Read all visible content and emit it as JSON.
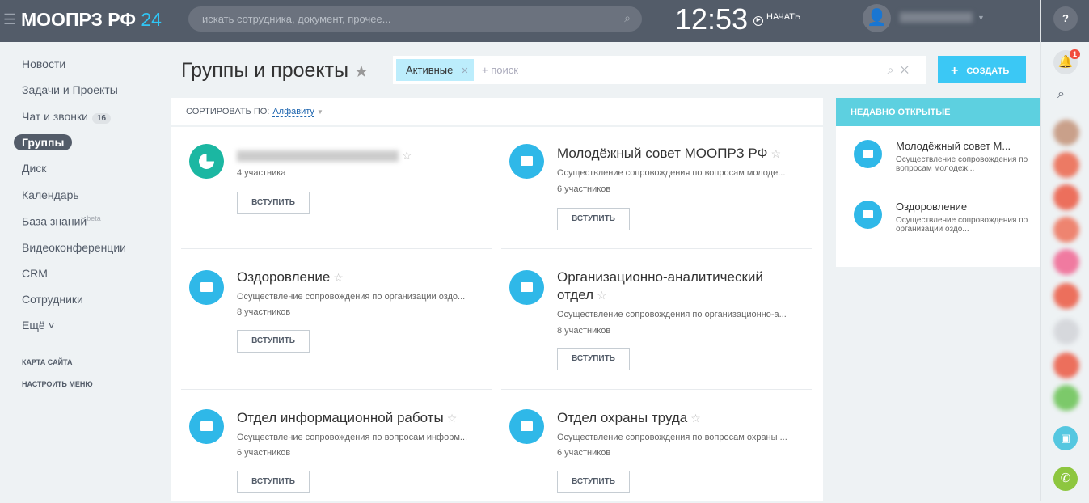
{
  "header": {
    "logo": "МООПРЗ РФ",
    "logo_num": "24",
    "search_placeholder": "искать сотрудника, документ, прочее...",
    "clock": "12:53",
    "start": "НАЧАТЬ"
  },
  "sidebar": {
    "items": [
      {
        "label": "Новости"
      },
      {
        "label": "Задачи и Проекты"
      },
      {
        "label": "Чат и звонки",
        "count": "16"
      },
      {
        "label": "Группы"
      },
      {
        "label": "Диск"
      },
      {
        "label": "Календарь"
      },
      {
        "label": "База знаний",
        "sup": "beta"
      },
      {
        "label": "Видеоконференции"
      },
      {
        "label": "CRM"
      },
      {
        "label": "Сотрудники"
      },
      {
        "label": "Ещё ˅"
      }
    ],
    "sitemap": "КАРТА САЙТА",
    "configure": "НАСТРОИТЬ МЕНЮ"
  },
  "page": {
    "title": "Группы и проекты",
    "filter_chip": "Активные",
    "search_placeholder": "+ поиск",
    "create": "СОЗДАТЬ",
    "sort_label": "СОРТИРОВАТЬ ПО:",
    "sort_value": "Алфавиту"
  },
  "groups": [
    {
      "title": "",
      "members": "4 участника",
      "join": "ВСТУПИТЬ"
    },
    {
      "title": "Молодёжный совет МООПРЗ РФ",
      "desc": "Осуществление сопровождения по вопросам молоде...",
      "members": "6 участников",
      "join": "ВСТУПИТЬ"
    },
    {
      "title": "Оздоровление",
      "desc": "Осуществление сопровождения по организации оздо...",
      "members": "8 участников",
      "join": "ВСТУПИТЬ"
    },
    {
      "title": "Организационно-аналитический отдел",
      "desc": "Осуществление сопровождения по организационно-а...",
      "members": "8 участников",
      "join": "ВСТУПИТЬ"
    },
    {
      "title": "Отдел информационной работы",
      "desc": "Осуществление сопровождения по вопросам информ...",
      "members": "6 участников",
      "join": "ВСТУПИТЬ"
    },
    {
      "title": "Отдел охраны труда",
      "desc": "Осуществление сопровождения по вопросам охраны ...",
      "members": "6 участников",
      "join": "ВСТУПИТЬ"
    }
  ],
  "recent": {
    "title": "НЕДАВНО ОТКРЫТЫЕ",
    "items": [
      {
        "title": "Молодёжный совет М...",
        "desc": "Осуществление сопровождения по вопросам молодеж..."
      },
      {
        "title": "Оздоровление",
        "desc": "Осуществление сопровождения по организации оздо..."
      }
    ]
  },
  "rightbar": {
    "notifications": "1",
    "help": "?"
  },
  "colors": {
    "header": "#535c69",
    "accent": "#2fc6f6",
    "recent_header": "#5dd0e0"
  }
}
